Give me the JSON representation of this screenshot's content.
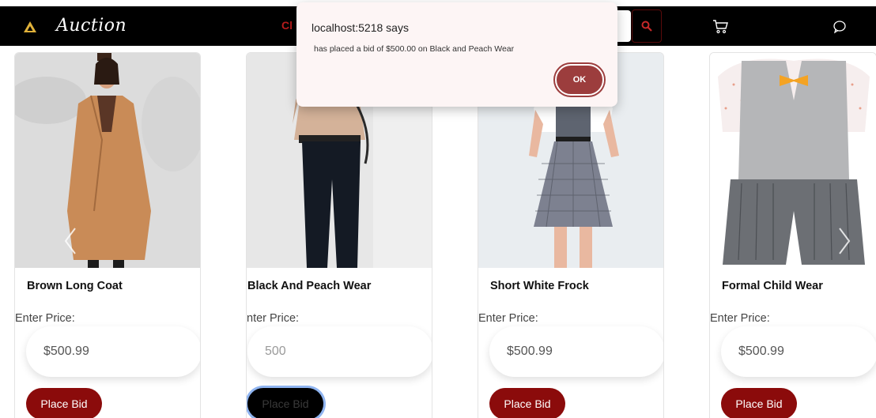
{
  "brand": {
    "name": "Auction"
  },
  "nav": {
    "link_text": "Cl"
  },
  "dialog": {
    "title": "localhost:5218 says",
    "message": "has placed a bid of $500.00 on Black and Peach Wear",
    "ok_label": "OK"
  },
  "products": [
    {
      "title": "Brown Long Coat",
      "price_label": "Enter Price:",
      "price_value": "$500.99",
      "bid_label": "Place Bid"
    },
    {
      "title": "Black And Peach Wear",
      "price_label": "nter Price:",
      "price_value": "500",
      "bid_label": "Place Bid"
    },
    {
      "title": "Short White Frock",
      "price_label": "Enter Price:",
      "price_value": "$500.99",
      "bid_label": "Place Bid"
    },
    {
      "title": "Formal Child Wear",
      "price_label": "Enter Price:",
      "price_value": "$500.99",
      "bid_label": "Place Bid"
    }
  ],
  "icons": {
    "logo": "logo-icon",
    "search": "search-icon",
    "cart": "cart-icon",
    "chat": "chat-icon",
    "prev": "chevron-left-icon",
    "next": "chevron-right-icon"
  },
  "colors": {
    "accent": "#8b0b0b",
    "navbar": "#000000",
    "dialog_button": "#9c3d3d"
  }
}
